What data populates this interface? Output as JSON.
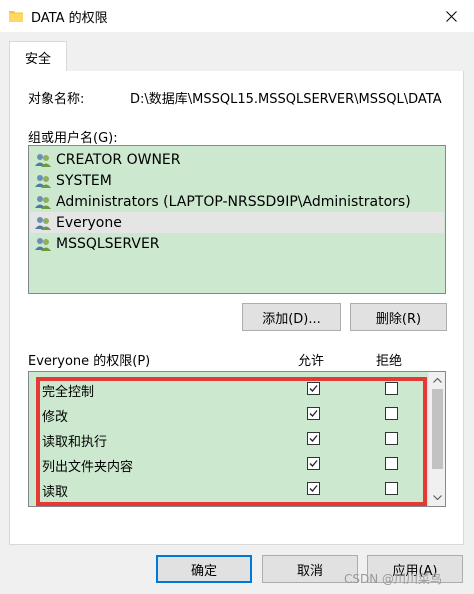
{
  "window": {
    "title": "DATA 的权限"
  },
  "tab": {
    "label": "安全"
  },
  "object": {
    "label": "对象名称:",
    "value": "D:\\数据库\\MSSQL15.MSSQLSERVER\\MSSQL\\DATA"
  },
  "groups": {
    "label": "组或用户名(G):",
    "users": [
      {
        "name": "CREATOR OWNER",
        "selected": false
      },
      {
        "name": "SYSTEM",
        "selected": false
      },
      {
        "name": "Administrators (LAPTOP-NRSSD9IP\\Administrators)",
        "selected": false
      },
      {
        "name": "Everyone",
        "selected": true
      },
      {
        "name": "MSSQLSERVER",
        "selected": false
      }
    ],
    "add_button": "添加(D)...",
    "remove_button": "删除(R)"
  },
  "permissions": {
    "title": "Everyone 的权限(P)",
    "allow_header": "允许",
    "deny_header": "拒绝",
    "rows": [
      {
        "name": "完全控制",
        "allow": true,
        "deny": false
      },
      {
        "name": "修改",
        "allow": true,
        "deny": false
      },
      {
        "name": "读取和执行",
        "allow": true,
        "deny": false
      },
      {
        "name": "列出文件夹内容",
        "allow": true,
        "deny": false
      },
      {
        "name": "读取",
        "allow": true,
        "deny": false
      }
    ]
  },
  "footer": {
    "ok_button": "确定",
    "cancel_button": "取消",
    "apply_button": "应用(A)"
  },
  "watermark": "CSDN @川川菜鸟",
  "colors": {
    "list_background": "#cce8cf",
    "selected_row": "#e5e5e5",
    "highlight_border": "#e53935",
    "default_button_border": "#0078d7"
  },
  "icons": {
    "title": "folder-icon",
    "close": "close-icon",
    "user": "users-group-icon",
    "check": "checkmark-icon"
  }
}
